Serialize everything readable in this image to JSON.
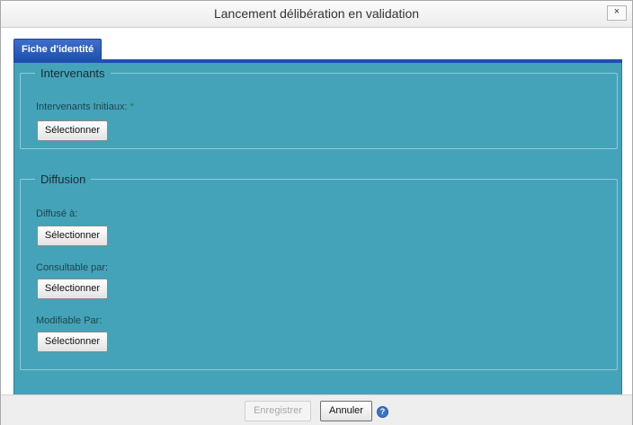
{
  "dialog": {
    "title": "Lancement délibération en validation",
    "close_label": "×"
  },
  "tabs": [
    {
      "label": "Fiche d'identité",
      "active": true
    }
  ],
  "groups": {
    "intervenants": {
      "legend": "Intervenants",
      "fields": [
        {
          "label": "Intervenants Initiaux:",
          "required_mark": "*",
          "button_label": "Sélectionner"
        }
      ]
    },
    "diffusion": {
      "legend": "Diffusion",
      "fields": [
        {
          "label": "Diffusé à:",
          "button_label": "Sélectionner"
        },
        {
          "label": "Consultable par:",
          "button_label": "Sélectionner"
        },
        {
          "label": "Modifiable Par:",
          "button_label": "Sélectionner"
        }
      ]
    }
  },
  "footer": {
    "save_label": "Enregistrer",
    "save_disabled": true,
    "cancel_label": "Annuler",
    "help_glyph": "?"
  },
  "colors": {
    "panel_bg": "#44a3b8",
    "tab_blue": "#1f4fae"
  }
}
